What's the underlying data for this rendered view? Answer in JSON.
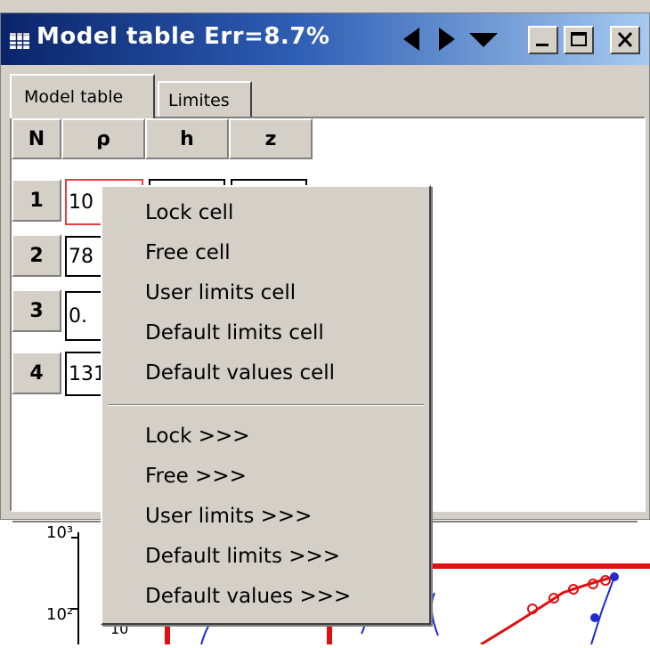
{
  "window": {
    "title": "Model table Err=8.7%"
  },
  "tabs": [
    {
      "label": "Model table",
      "active": true
    },
    {
      "label": "Limites",
      "active": false
    }
  ],
  "table": {
    "headers": [
      "N",
      "ρ",
      "h",
      "z"
    ],
    "rows": [
      {
        "n": "1",
        "rho": "10",
        "h": "",
        "z": ""
      },
      {
        "n": "2",
        "rho": "78",
        "h": "",
        "z": ""
      },
      {
        "n": "3",
        "rho": "0.",
        "h": "",
        "z": ""
      },
      {
        "n": "4",
        "rho": "131",
        "h": "",
        "z": ""
      }
    ]
  },
  "context_menu": {
    "group1": [
      "Lock cell",
      "Free cell",
      "User limits cell",
      "Default limits cell",
      "Default values cell"
    ],
    "group2": [
      "Lock >>>",
      "Free >>>",
      "User limits >>>",
      "Default limits >>>",
      "Default values >>>"
    ]
  },
  "plot": {
    "y_tick_labels": [
      "10³",
      "10²",
      "10"
    ]
  },
  "colors": {
    "title_gradient_start": "#0a246a",
    "title_gradient_end": "#a6caf0",
    "chrome": "#d4d0c8",
    "selected_cell_border": "#e04040",
    "plot_red": "#e01010",
    "plot_blue": "#1c2cd0"
  }
}
